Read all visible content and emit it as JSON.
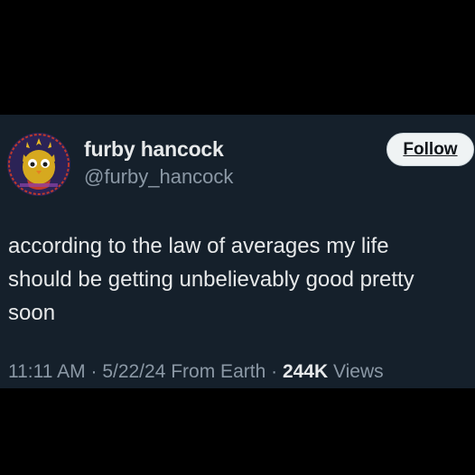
{
  "tweet": {
    "display_name": "furby hancock",
    "handle": "@furby_hancock",
    "follow_label": "Follow",
    "text_lines": [
      "according to the law of averages my life",
      "should be getting unbelievably good pretty",
      "soon"
    ],
    "time": "11:11 AM",
    "date": "5/22/24",
    "source": "From Earth",
    "separator": "·",
    "views_count": "244K",
    "views_label": "Views"
  },
  "colors": {
    "page_background": "#000000",
    "card_background": "#15202b",
    "primary_text": "#e7e9ea",
    "secondary_text": "#8b98a5",
    "follow_button_bg": "#eff3f4"
  },
  "icons": {
    "avatar": "furby-avatar-icon"
  }
}
